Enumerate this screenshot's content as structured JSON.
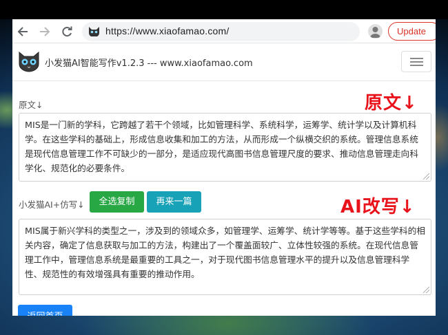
{
  "browser": {
    "url": "https://www.xiaofamao.com/",
    "update_label": "Update",
    "icons": [
      "back-arrow-icon",
      "forward-arrow-icon",
      "reload-icon",
      "site-cat-icon",
      "profile-icon"
    ]
  },
  "navbar": {
    "brand": "小发猫AI智能写作v1.2.3 --- www.xiaofamao.com",
    "menu_icon": "hamburger-icon"
  },
  "original": {
    "label": "原文↓",
    "overlay": "原文↓",
    "text": "MIS是一门新的学科，它跨越了若干个领域，比如管理科学、系统科学，运筹学、统计学以及计算机科学。在这些学科的基础上，形成信息收集和加工的方法，从而形成一个纵横交织的系统。管理信息系统是现代信息管理工作不可缺少的一部分，是适应现代高图书信息管理尺度的要求、推动信息管理走向科学化、规范化的必要条件。"
  },
  "rewrite": {
    "label": "小发猫AI+仿写↓",
    "overlay": "AI改写↓",
    "select_all_button": "全选复制",
    "again_button": "再来一篇",
    "text": "MIS属于新兴学科的类型之一，涉及到的领域众多，如管理学、运筹学、统计学等等。基于这些学科的相关内容，确定了信息获取与加工的方法，构建出了一个覆盖面较广、立体性较强的系统。在现代信息管理工作中，管理信息系统是最重要的工具之一，对于现代图书信息管理水平的提升以及信息管理科学性、规范性的有效增强具有重要的推动作用。"
  },
  "back_button": "返回首页",
  "colors": {
    "overlay_red": "#e8131b",
    "green_button": "#28a745",
    "teal_button": "#17a2b8",
    "blue_button": "#1a82f7",
    "update_red": "#d93025"
  }
}
